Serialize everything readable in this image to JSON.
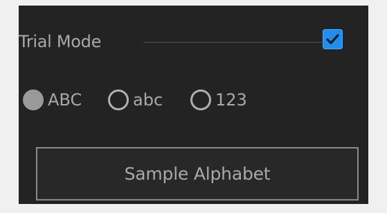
{
  "settings": {
    "trial_mode": {
      "label": "Trial Mode",
      "checked": true,
      "check_icon": "checkmark-icon"
    },
    "alphabet_options": [
      {
        "label": "ABC",
        "selected": true
      },
      {
        "label": "abc",
        "selected": false
      },
      {
        "label": "123",
        "selected": false
      }
    ],
    "sample_button": {
      "label": "Sample Alphabet"
    }
  },
  "colors": {
    "background": "#232323",
    "text": "#a9a9a9",
    "accent": "#1e8ef0",
    "button_border": "#8a8a8a"
  }
}
